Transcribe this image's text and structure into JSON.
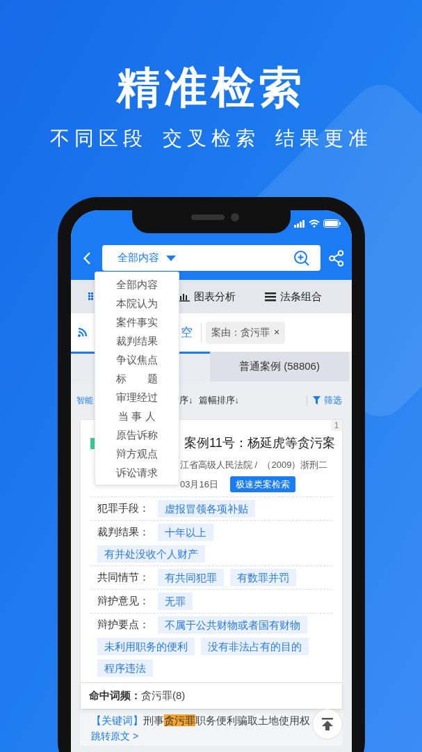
{
  "headline": "精准检索",
  "subtitle": [
    "不同区段",
    "交叉检索",
    "结果更准"
  ],
  "search": {
    "scope": "全部内容"
  },
  "scope_menu": [
    {
      "label": "全部内容"
    },
    {
      "label": "本院认为"
    },
    {
      "label": "案件事实"
    },
    {
      "label": "裁判结果"
    },
    {
      "label": "争议焦点"
    },
    {
      "label": "标　　题"
    },
    {
      "label": "审理经过"
    },
    {
      "label": "当 事 人"
    },
    {
      "label": "原告诉称"
    },
    {
      "label": "辩方观点"
    },
    {
      "label": "诉讼请求"
    }
  ],
  "toolbar_tabs": [
    {
      "kind": "grid"
    },
    {
      "kind": "chart",
      "label": "图表分析"
    },
    {
      "kind": "list",
      "label": "法条组合"
    }
  ],
  "filter": {
    "clear_fragment": "空",
    "chips": [
      {
        "label": "案由：贪污罪",
        "close": "×"
      }
    ]
  },
  "case_tabs": [
    {
      "selected": true
    },
    {
      "label": "普通案例 (58806)",
      "selected": false
    }
  ],
  "sort": {
    "fragments": [
      "智能",
      "序↓"
    ],
    "items": [
      "篇幅排序↓"
    ],
    "filter_label": "筛选"
  },
  "result": {
    "index": "1",
    "title": "案例11号：杨延虎等贪污案",
    "meta_lines": [
      "江省高级人民法院 /  （2009）浙刑二",
      "03月16日"
    ],
    "badge": "极速类案检索",
    "facets": [
      {
        "label": "犯罪手段：",
        "tags": [
          "虚报冒领各项补贴"
        ]
      },
      {
        "label": "裁判结果：",
        "tags": [
          "十年以上",
          "有并处没收个人财产"
        ]
      },
      {
        "label": "共同情节：",
        "tags": [
          "有共同犯罪",
          "有数罪并罚"
        ]
      },
      {
        "label": "辩护意见：",
        "tags": [
          "无罪"
        ]
      },
      {
        "label": "辩护要点：",
        "tags": [
          "不属于公共财物或者国有财物",
          "未利用职务的便利",
          "没有非法占有的目的",
          "程序违法"
        ]
      }
    ],
    "hit_label": "命中词频：",
    "hit_value": "贪污罪(8)",
    "keywords": {
      "label": "【关键词】",
      "parts": [
        {
          "text": "刑事",
          "highlight": false
        },
        {
          "text": "贪污罪",
          "highlight": true
        },
        {
          "text": "职务便利骗取土地使用权",
          "highlight": false
        }
      ]
    },
    "jump_link": "跳转原文 >"
  }
}
